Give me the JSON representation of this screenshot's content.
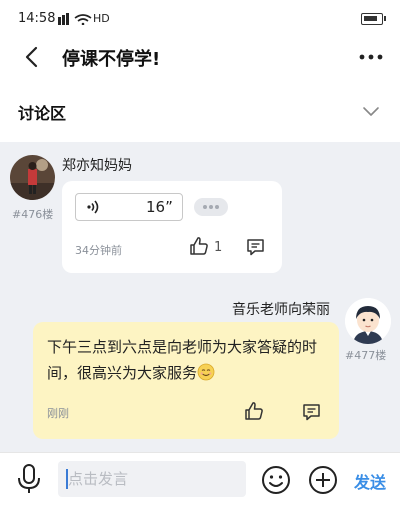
{
  "status_bar": {
    "time": "14:58",
    "network": "HD"
  },
  "nav": {
    "title": "停课不停学!"
  },
  "section": {
    "label": "讨论区"
  },
  "posts": [
    {
      "author": "郑亦知妈妈",
      "floor": "#476楼",
      "voice_duration": "16”",
      "time": "34分钟前",
      "likes": "1"
    },
    {
      "author": "音乐老师向荣丽",
      "floor": "#477楼",
      "message": "下午三点到六点是向老师为大家答疑的时间，很高兴为大家服务",
      "time": "刚刚"
    }
  ],
  "composer": {
    "placeholder": "点击发言",
    "send_label": "发送"
  },
  "colors": {
    "accent": "#3a8ee6",
    "teacher_bubble": "#fdf4c3",
    "feed_bg": "#eef0f4"
  }
}
